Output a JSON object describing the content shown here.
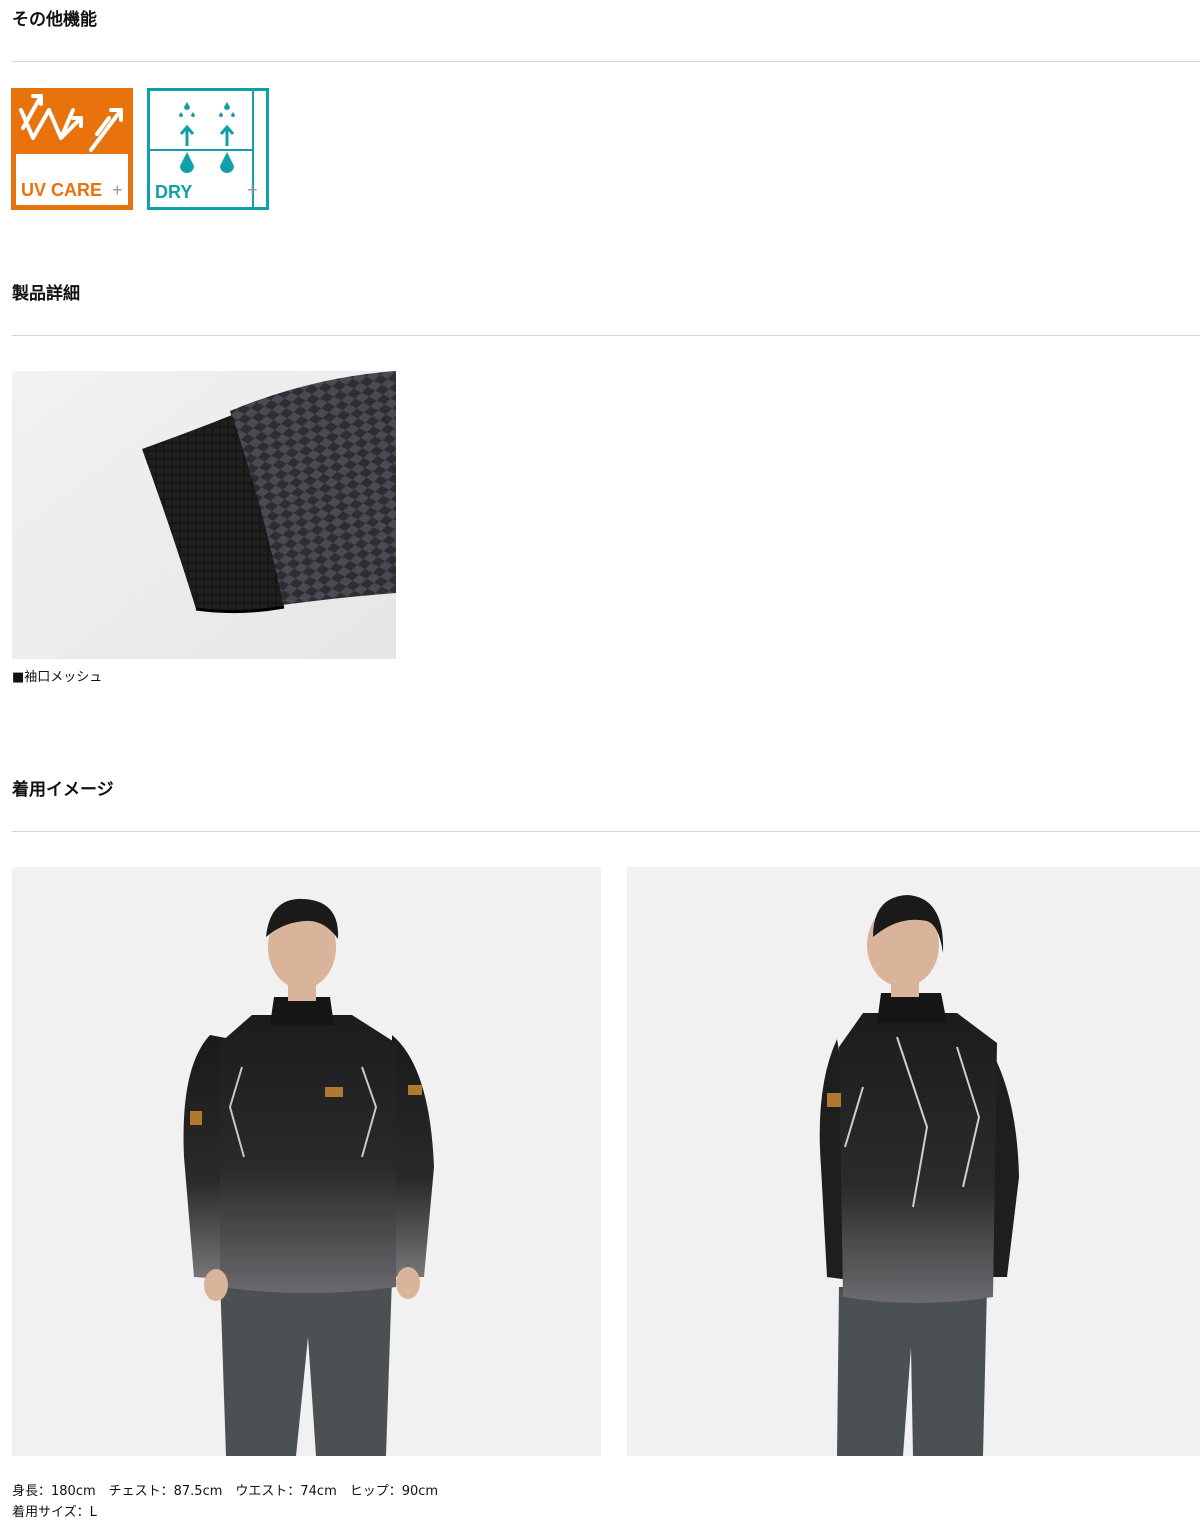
{
  "sections": {
    "features": {
      "title": "その他機能"
    },
    "details": {
      "title": "製品詳細"
    },
    "wearing": {
      "title": "着用イメージ"
    }
  },
  "badges": {
    "uv": {
      "label": "UV CARE",
      "plus": "+",
      "color": "#E8720C"
    },
    "dry": {
      "label": "DRY",
      "plus": "+",
      "color": "#12A0A8"
    }
  },
  "detail_image": {
    "icon": "sleeve-cuff-mesh-photo",
    "caption": "■袖口メッシュ"
  },
  "model_images": {
    "front_icon": "model-front-photo",
    "back_icon": "model-back-photo"
  },
  "model_info": {
    "line1": "身長：180cm　チェスト：87.5cm　ウエスト：74cm　ヒップ：90cm",
    "line2": "着用サイズ：L"
  }
}
